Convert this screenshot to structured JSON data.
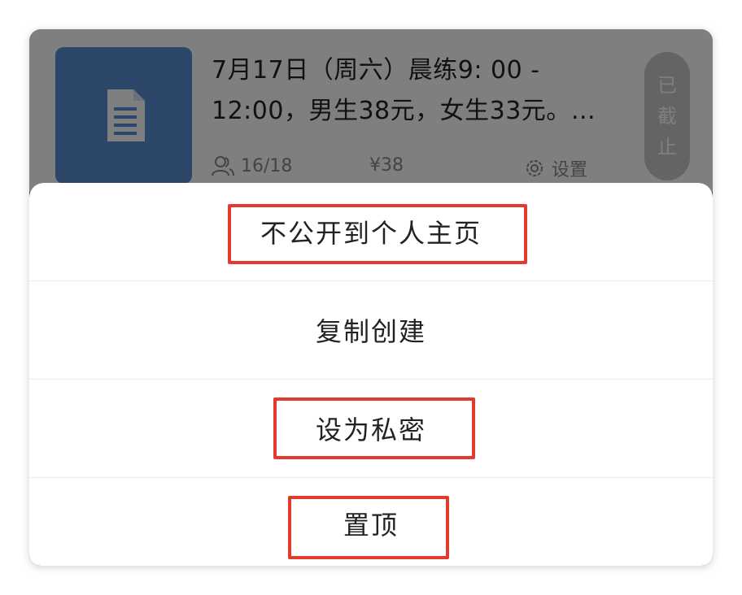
{
  "card": {
    "title": "7月17日（周六）晨练9: 00 - 12:00，男生38元，女生33元。…",
    "participants": "16/18",
    "price": "¥38",
    "settings_label": "设置",
    "status_badge": [
      "已",
      "截",
      "止"
    ]
  },
  "action_sheet": {
    "items": [
      {
        "label": "不公开到个人主页",
        "highlighted": true
      },
      {
        "label": "复制创建",
        "highlighted": false
      },
      {
        "label": "设为私密",
        "highlighted": true
      },
      {
        "label": "置顶",
        "highlighted": true
      }
    ]
  },
  "colors": {
    "highlight": "#e23b2e",
    "thumbnail": "#5b8fd6",
    "overlay": "rgba(0,0,0,0.5)"
  }
}
